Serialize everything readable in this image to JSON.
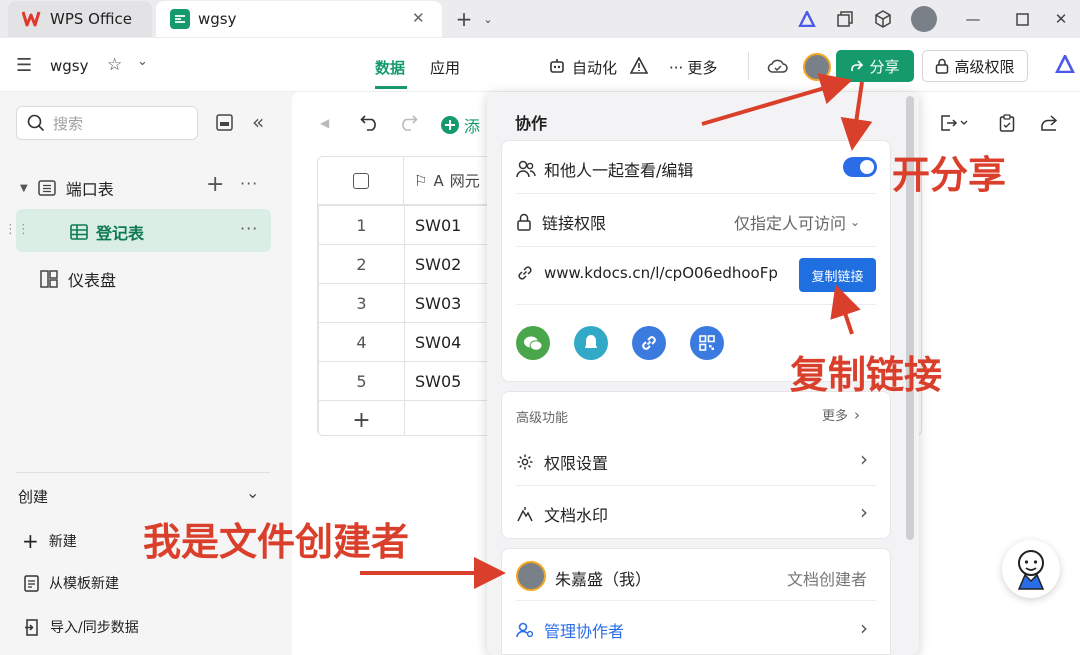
{
  "tabs": [
    {
      "label": "WPS Office"
    },
    {
      "label": "wgsy"
    }
  ],
  "toolbar": {
    "doc_name": "wgsy",
    "tab_data": "数据",
    "tab_app": "应用",
    "automation": "自动化",
    "more": "更多",
    "share": "分享",
    "advanced_perm": "高级权限"
  },
  "sidebar": {
    "search_placeholder": "搜索",
    "items": [
      {
        "label": "端口表"
      },
      {
        "label": "登记表"
      },
      {
        "label": "仪表盘"
      }
    ],
    "create_title": "创建",
    "bottom": [
      {
        "label": "新建"
      },
      {
        "label": "从模板新建"
      },
      {
        "label": "导入/同步数据"
      }
    ]
  },
  "grid": {
    "add_label": "添",
    "column_header": "网元",
    "rows": [
      {
        "num": "1",
        "val": "SW01"
      },
      {
        "num": "2",
        "val": "SW02"
      },
      {
        "num": "3",
        "val": "SW03"
      },
      {
        "num": "4",
        "val": "SW04"
      },
      {
        "num": "5",
        "val": "SW05"
      }
    ]
  },
  "popup": {
    "title": "协作",
    "collab_toggle_label": "和他人一起查看/编辑",
    "link_perm_label": "链接权限",
    "link_perm_value": "仅指定人可访问",
    "link_url": "www.kdocs.cn/l/cpO06edhooFp",
    "copy_link": "复制链接",
    "advanced_title": "高级功能",
    "advanced_more": "更多",
    "perm_settings": "权限设置",
    "watermark": "文档水印",
    "user_name": "朱嘉盛（我）",
    "user_role": "文档创建者",
    "manage": "管理协作者"
  },
  "annotations": {
    "open_share": "开分享",
    "copy_link": "复制链接",
    "creator": "我是文件创建者"
  },
  "colors": {
    "brand_green": "#159a6c",
    "accent_blue": "#2b6de8",
    "annotation_red": "#d93f2b"
  }
}
